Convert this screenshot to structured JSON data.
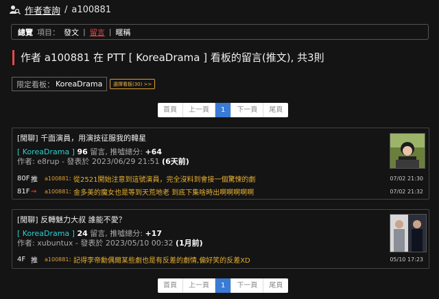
{
  "header": {
    "crumb_link": "作者查詢",
    "crumb_sep": "/",
    "crumb_current": "a100881",
    "icon": "user-search-icon"
  },
  "nav": {
    "overview": "總覽",
    "items_label": "項目：",
    "posts": "發文",
    "comments": "留言",
    "nicknames": "暱稱",
    "sep": "|"
  },
  "page_title": "作者 a100881 在 PTT [ KoreaDrama ] 看板的留言(推文), 共3則",
  "filter": {
    "label": "限定看板：",
    "value": "KoreaDrama",
    "select_button": "選擇看板(30) >>"
  },
  "pagination": {
    "first": "首頁",
    "prev": "上一頁",
    "current": "1",
    "next": "下一頁",
    "last": "尾頁"
  },
  "posts": [
    {
      "title": "[閒聊] 千面演員，用演技征服我的韓星",
      "board": "[ KoreaDrama ]",
      "comment_count": "96",
      "comment_label": "留言, 推噓總分:",
      "score": "+64",
      "author_label": "作者:",
      "author": "e8rup",
      "date_label": "- 發表於",
      "date": "2023/06/29 21:51",
      "ago": "(6天前)",
      "comments": [
        {
          "floor": "80F",
          "tag": "推",
          "uid": "a100881",
          "text": "從2521開始注意到這號演員，完全沒料到會接一個驚悚的劇",
          "time": "07/02 21:30"
        },
        {
          "floor": "81F",
          "tag": "→",
          "uid": "a100881",
          "text": "金多美的魔女也是等到天荒地老 到底下集啥時出啊啊啊啊啊",
          "time": "07/02 21:32"
        }
      ]
    },
    {
      "title": "[閒聊] 反轉魅力大叔 誰能不愛？",
      "board": "[ KoreaDrama ]",
      "comment_count": "24",
      "comment_label": "留言, 推噓總分:",
      "score": "+17",
      "author_label": "作者:",
      "author": "xubuntux",
      "date_label": "- 發表於",
      "date": "2023/05/10 00:32",
      "ago": "(1月前)",
      "comments": [
        {
          "floor": "4F",
          "tag": "推",
          "uid": "a100881",
          "text": "記得李帝勳偶爾某些劇也是有反差的劇情,偏好笑的反差XD",
          "time": "05/10 17:23"
        }
      ]
    }
  ],
  "colors": {
    "accent_red": "#e8484a",
    "board_cyan": "#2ecfcf",
    "comment_orange": "#e8a030",
    "pager_blue": "#3a7bd5"
  }
}
